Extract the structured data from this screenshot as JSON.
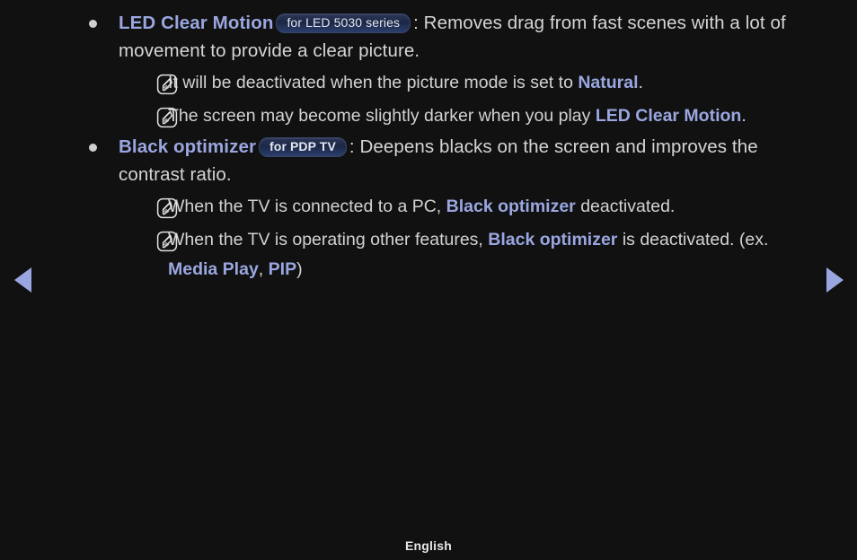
{
  "page": {
    "background_color": "#111111",
    "text_color": "#d5d5d5",
    "accent_color": "#9aa6e0",
    "footer_label": "English"
  },
  "nav": {
    "prev_label": "◀",
    "next_label": "▶",
    "arrow_color": "#9aa6e0"
  },
  "sections": [
    {
      "id": "led-clear-motion",
      "term": "LED Clear Motion",
      "badge": "for LED 5030 series",
      "badge_bold": false,
      "colon": ":",
      "description": "Removes drag from fast scenes with a lot of movement to provide a clear picture.",
      "notes": [
        {
          "icon": "note-pencil-icon",
          "parts": [
            {
              "text": "It will be deactivated when the picture mode is set to ",
              "style": "normal"
            },
            {
              "text": "Natural",
              "style": "term"
            },
            {
              "text": ".",
              "style": "normal"
            }
          ]
        },
        {
          "icon": "note-pencil-icon",
          "parts": [
            {
              "text": "The screen may become slightly darker when you play ",
              "style": "normal"
            },
            {
              "text": "LED Clear Motion",
              "style": "term"
            },
            {
              "text": ".",
              "style": "normal"
            }
          ]
        }
      ]
    },
    {
      "id": "black-optimizer",
      "term": "Black optimizer",
      "badge": "for PDP TV",
      "badge_bold": true,
      "colon": ":",
      "description": "Deepens blacks on the screen and improves the contrast ratio.",
      "notes": [
        {
          "icon": "note-pencil-icon",
          "parts": [
            {
              "text": "When the TV is connected to a PC, ",
              "style": "normal"
            },
            {
              "text": "Black optimizer",
              "style": "term"
            },
            {
              "text": " deactivated.",
              "style": "normal"
            }
          ]
        },
        {
          "icon": "note-pencil-icon",
          "parts": [
            {
              "text": "When the TV is operating other features, ",
              "style": "normal"
            },
            {
              "text": "Black optimizer",
              "style": "term"
            },
            {
              "text": " is deactivated. (ex. ",
              "style": "normal"
            },
            {
              "text": "Media Play",
              "style": "term"
            },
            {
              "text": ", ",
              "style": "normal"
            },
            {
              "text": "PIP",
              "style": "term"
            },
            {
              "text": ")",
              "style": "normal"
            }
          ]
        }
      ]
    }
  ]
}
